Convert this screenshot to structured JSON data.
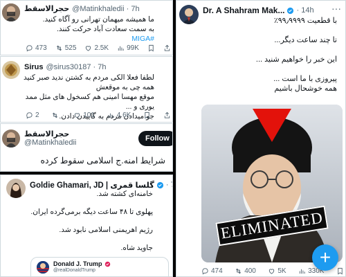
{
  "tweet1": {
    "name": "حجرالاسقط",
    "handle": "@Matinkhaledii · 7h",
    "line1": "ما همیشه میهمان تهرانی رو آگاه کنید.",
    "line2": "به سمت سعادت آباد حرکت کنند.",
    "hashtag": "#MIGA",
    "replies": "473",
    "retweets": "525",
    "likes": "2.5K",
    "views": "99K"
  },
  "tweet2": {
    "name": "Sirus",
    "handle": "@sirus30187 · 7h",
    "line1": "لطفا فعلا الکی مردم به کشتن ندید صبر کنید",
    "line2": "همه چی به موقعش",
    "line3": "موقع مهسا امینی هم کسخول های مثل ممد یوری و ...",
    "line4": "جو میدادن مردم به گاییدن دادن.",
    "replies": "2",
    "retweets": "",
    "likes": "101",
    "views": "4.6K"
  },
  "tweet3": {
    "name": "حجرالاسقط",
    "handle": "@Matinkhaledii",
    "follow_label": "Follow",
    "text": "شرایط امنه.ج اسلامی سقوط کرده"
  },
  "tweet4": {
    "name": "Goldie Ghamari, JD | گلسا قمری",
    "time": "· 7 u",
    "line1": "خامنه‌ای کشته شد.",
    "line2": "پهلوی تا ۴۸ ساعت دیگه برمی‌گرده ایران.",
    "line3": "رژیم اهریمنی اسلامی نابود شد.",
    "line4": "جاوید شاه.",
    "quoted_name": "Donald J. Trump",
    "quoted_handle": "@realDonaldTrump"
  },
  "tweet5": {
    "name": "Dr. A Shahram Mak...",
    "time": "· 14h",
    "line1": "با قطعیت ۹۹٫۹۹۹۹٪",
    "line2": "تا چند ساعت دیگر...",
    "line3": "این خبر را خواهیم شنید ...",
    "line4": "پیروزی با ما است ...",
    "line5": "همه خوشحال باشیم",
    "image_label": "ELIMINATED",
    "replies": "474",
    "retweets": "400",
    "likes": "5K",
    "views": "330K"
  },
  "fab": {
    "label": "+"
  },
  "colors": {
    "accent": "#1d9bf0",
    "text": "#0f1419",
    "muted": "#536471",
    "triangle": "#e3120b"
  },
  "icons": [
    "reply-icon",
    "retweet-icon",
    "like-icon",
    "views-icon",
    "bookmark-icon",
    "share-icon",
    "verified-icon",
    "more-icon",
    "plus-icon"
  ]
}
